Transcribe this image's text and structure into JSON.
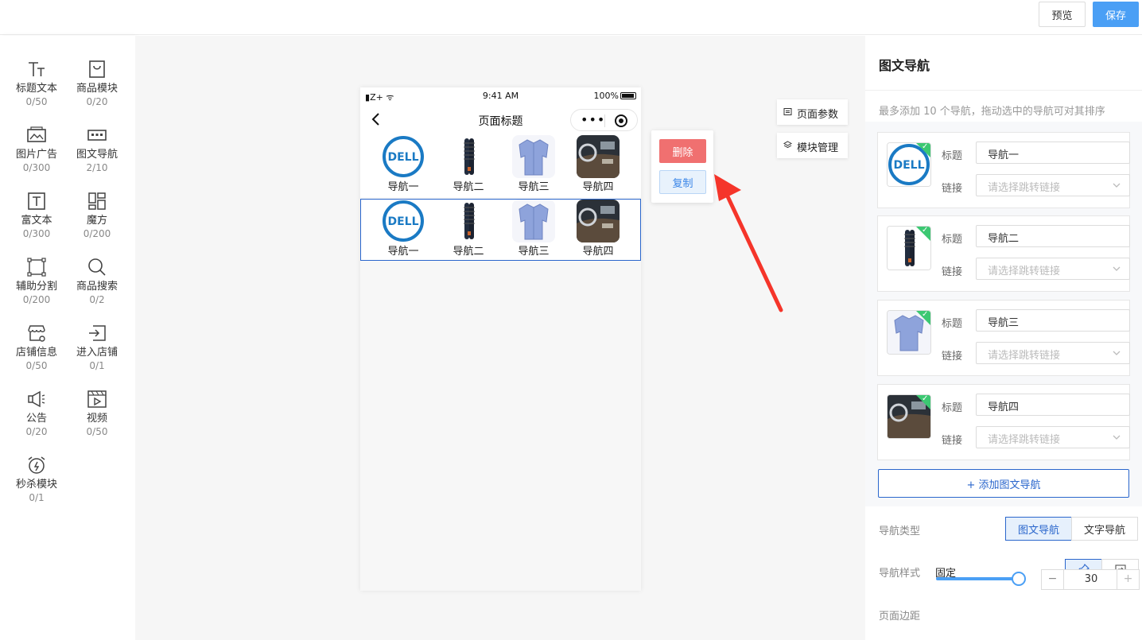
{
  "toolbar": {
    "preview_label": "预览",
    "save_label": "保存"
  },
  "components": [
    {
      "label": "标题文本",
      "count": "0/50",
      "icon": "title-text-icon"
    },
    {
      "label": "商品模块",
      "count": "0/20",
      "icon": "shopping-bag-icon"
    },
    {
      "label": "图片广告",
      "count": "0/300",
      "icon": "image-ad-icon"
    },
    {
      "label": "图文导航",
      "count": "2/10",
      "icon": "image-nav-icon"
    },
    {
      "label": "富文本",
      "count": "0/300",
      "icon": "rich-text-icon"
    },
    {
      "label": "魔方",
      "count": "0/200",
      "icon": "magic-cube-icon"
    },
    {
      "label": "辅助分割",
      "count": "0/200",
      "icon": "divider-icon"
    },
    {
      "label": "商品搜索",
      "count": "0/2",
      "icon": "search-icon"
    },
    {
      "label": "店铺信息",
      "count": "0/50",
      "icon": "store-icon"
    },
    {
      "label": "进入店铺",
      "count": "0/1",
      "icon": "enter-store-icon"
    },
    {
      "label": "公告",
      "count": "0/20",
      "icon": "announcement-icon"
    },
    {
      "label": "视频",
      "count": "0/50",
      "icon": "video-icon"
    },
    {
      "label": "秒杀模块",
      "count": "0/1",
      "icon": "alarm-clock-icon"
    }
  ],
  "phone": {
    "status": {
      "signal": "Z+",
      "time": "9:41 AM",
      "battery": "100%"
    },
    "title": "页面标题",
    "rows": [
      {
        "items": [
          "导航一",
          "导航二",
          "导航三",
          "导航四"
        ]
      },
      {
        "items": [
          "导航一",
          "导航二",
          "导航三",
          "导航四"
        ]
      }
    ]
  },
  "popover": {
    "delete_label": "删除",
    "copy_label": "复制"
  },
  "side_buttons": {
    "page_params": "页面参数",
    "module_manage": "模块管理"
  },
  "panel": {
    "title": "图文导航",
    "hint": "最多添加 10 个导航，拖动选中的导航可对其排序",
    "title_label": "标题",
    "link_label": "链接",
    "link_placeholder": "请选择跳转链接",
    "items": [
      {
        "title": "导航一"
      },
      {
        "title": "导航二"
      },
      {
        "title": "导航三"
      },
      {
        "title": "导航四"
      }
    ],
    "add_label": "+ 添加图文导航",
    "nav_type_label": "导航类型",
    "nav_type_options": [
      "图文导航",
      "文字导航"
    ],
    "nav_style_label": "导航样式",
    "nav_style_value": "固定",
    "margin_label": "页面边距",
    "margin_value": "30",
    "stepper_minus": "−",
    "stepper_plus": "+"
  },
  "colors": {
    "accent": "#2a66cc",
    "save": "#4a9ff5",
    "danger": "#f07070",
    "check": "#3cc872"
  }
}
